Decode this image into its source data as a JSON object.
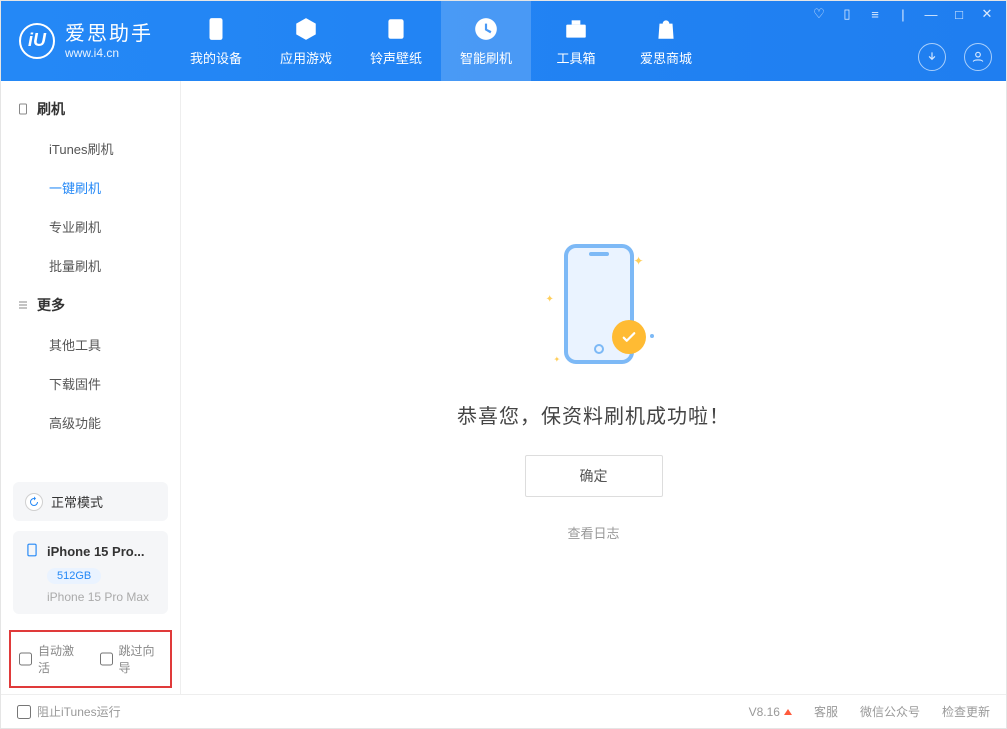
{
  "app": {
    "title": "爱思助手",
    "url": "www.i4.cn"
  },
  "nav": {
    "items": [
      {
        "label": "我的设备"
      },
      {
        "label": "应用游戏"
      },
      {
        "label": "铃声壁纸"
      },
      {
        "label": "智能刷机"
      },
      {
        "label": "工具箱"
      },
      {
        "label": "爱思商城"
      }
    ],
    "active_index": 3
  },
  "sidebar": {
    "group1": {
      "header": "刷机",
      "items": [
        "iTunes刷机",
        "一键刷机",
        "专业刷机",
        "批量刷机"
      ],
      "active_index": 1
    },
    "group2": {
      "header": "更多",
      "items": [
        "其他工具",
        "下载固件",
        "高级功能"
      ]
    }
  },
  "mode": {
    "label": "正常模式"
  },
  "device": {
    "name_short": "iPhone 15 Pro...",
    "storage": "512GB",
    "model": "iPhone 15 Pro Max"
  },
  "options": {
    "auto_activate": "自动激活",
    "skip_wizard": "跳过向导"
  },
  "main": {
    "success_text": "恭喜您，保资料刷机成功啦！",
    "ok_button": "确定",
    "view_log": "查看日志"
  },
  "footer": {
    "block_itunes": "阻止iTunes运行",
    "version": "V8.16",
    "links": [
      "客服",
      "微信公众号",
      "检查更新"
    ]
  }
}
